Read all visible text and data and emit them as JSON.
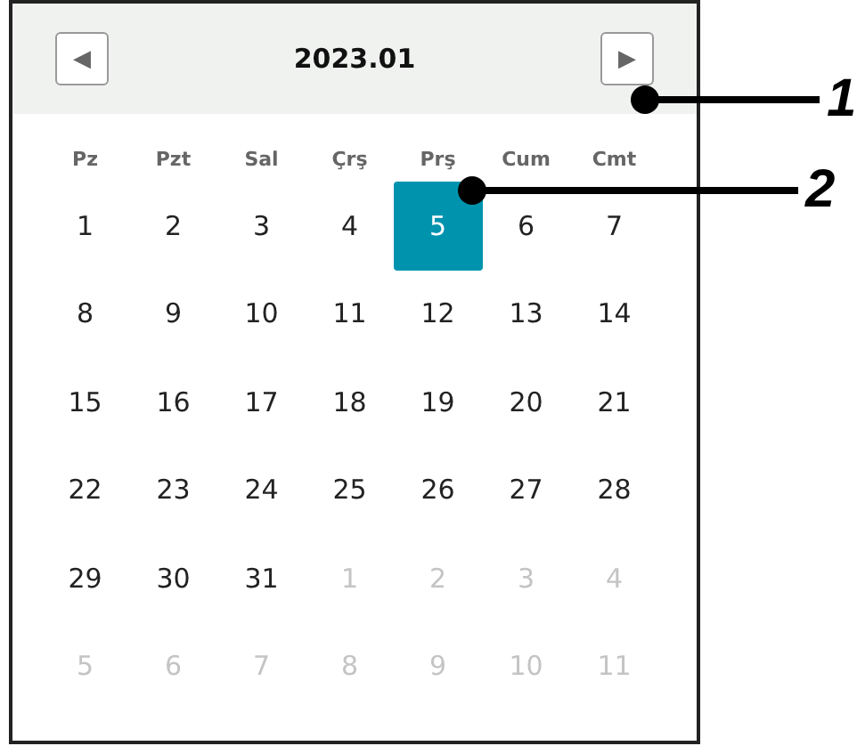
{
  "calendar": {
    "title": "2023.01",
    "prev_button": "◀",
    "next_button": "▶",
    "weekdays": [
      "Pz",
      "Pzt",
      "Sal",
      "Çrş",
      "Prş",
      "Cum",
      "Cmt"
    ],
    "weeks": [
      [
        {
          "day": "1",
          "outside": false,
          "selected": false
        },
        {
          "day": "2",
          "outside": false,
          "selected": false
        },
        {
          "day": "3",
          "outside": false,
          "selected": false
        },
        {
          "day": "4",
          "outside": false,
          "selected": false
        },
        {
          "day": "5",
          "outside": false,
          "selected": true
        },
        {
          "day": "6",
          "outside": false,
          "selected": false
        },
        {
          "day": "7",
          "outside": false,
          "selected": false
        }
      ],
      [
        {
          "day": "8",
          "outside": false,
          "selected": false
        },
        {
          "day": "9",
          "outside": false,
          "selected": false
        },
        {
          "day": "10",
          "outside": false,
          "selected": false
        },
        {
          "day": "11",
          "outside": false,
          "selected": false
        },
        {
          "day": "12",
          "outside": false,
          "selected": false
        },
        {
          "day": "13",
          "outside": false,
          "selected": false
        },
        {
          "day": "14",
          "outside": false,
          "selected": false
        }
      ],
      [
        {
          "day": "15",
          "outside": false,
          "selected": false
        },
        {
          "day": "16",
          "outside": false,
          "selected": false
        },
        {
          "day": "17",
          "outside": false,
          "selected": false
        },
        {
          "day": "18",
          "outside": false,
          "selected": false
        },
        {
          "day": "19",
          "outside": false,
          "selected": false
        },
        {
          "day": "20",
          "outside": false,
          "selected": false
        },
        {
          "day": "21",
          "outside": false,
          "selected": false
        }
      ],
      [
        {
          "day": "22",
          "outside": false,
          "selected": false
        },
        {
          "day": "23",
          "outside": false,
          "selected": false
        },
        {
          "day": "24",
          "outside": false,
          "selected": false
        },
        {
          "day": "25",
          "outside": false,
          "selected": false
        },
        {
          "day": "26",
          "outside": false,
          "selected": false
        },
        {
          "day": "27",
          "outside": false,
          "selected": false
        },
        {
          "day": "28",
          "outside": false,
          "selected": false
        }
      ],
      [
        {
          "day": "29",
          "outside": false,
          "selected": false
        },
        {
          "day": "30",
          "outside": false,
          "selected": false
        },
        {
          "day": "31",
          "outside": false,
          "selected": false
        },
        {
          "day": "1",
          "outside": true,
          "selected": false
        },
        {
          "day": "2",
          "outside": true,
          "selected": false
        },
        {
          "day": "3",
          "outside": true,
          "selected": false
        },
        {
          "day": "4",
          "outside": true,
          "selected": false
        }
      ],
      [
        {
          "day": "5",
          "outside": true,
          "selected": false
        },
        {
          "day": "6",
          "outside": true,
          "selected": false
        },
        {
          "day": "7",
          "outside": true,
          "selected": false
        },
        {
          "day": "8",
          "outside": true,
          "selected": false
        },
        {
          "day": "9",
          "outside": true,
          "selected": false
        },
        {
          "day": "10",
          "outside": true,
          "selected": false
        },
        {
          "day": "11",
          "outside": true,
          "selected": false
        }
      ]
    ]
  },
  "callouts": [
    "1",
    "2"
  ]
}
